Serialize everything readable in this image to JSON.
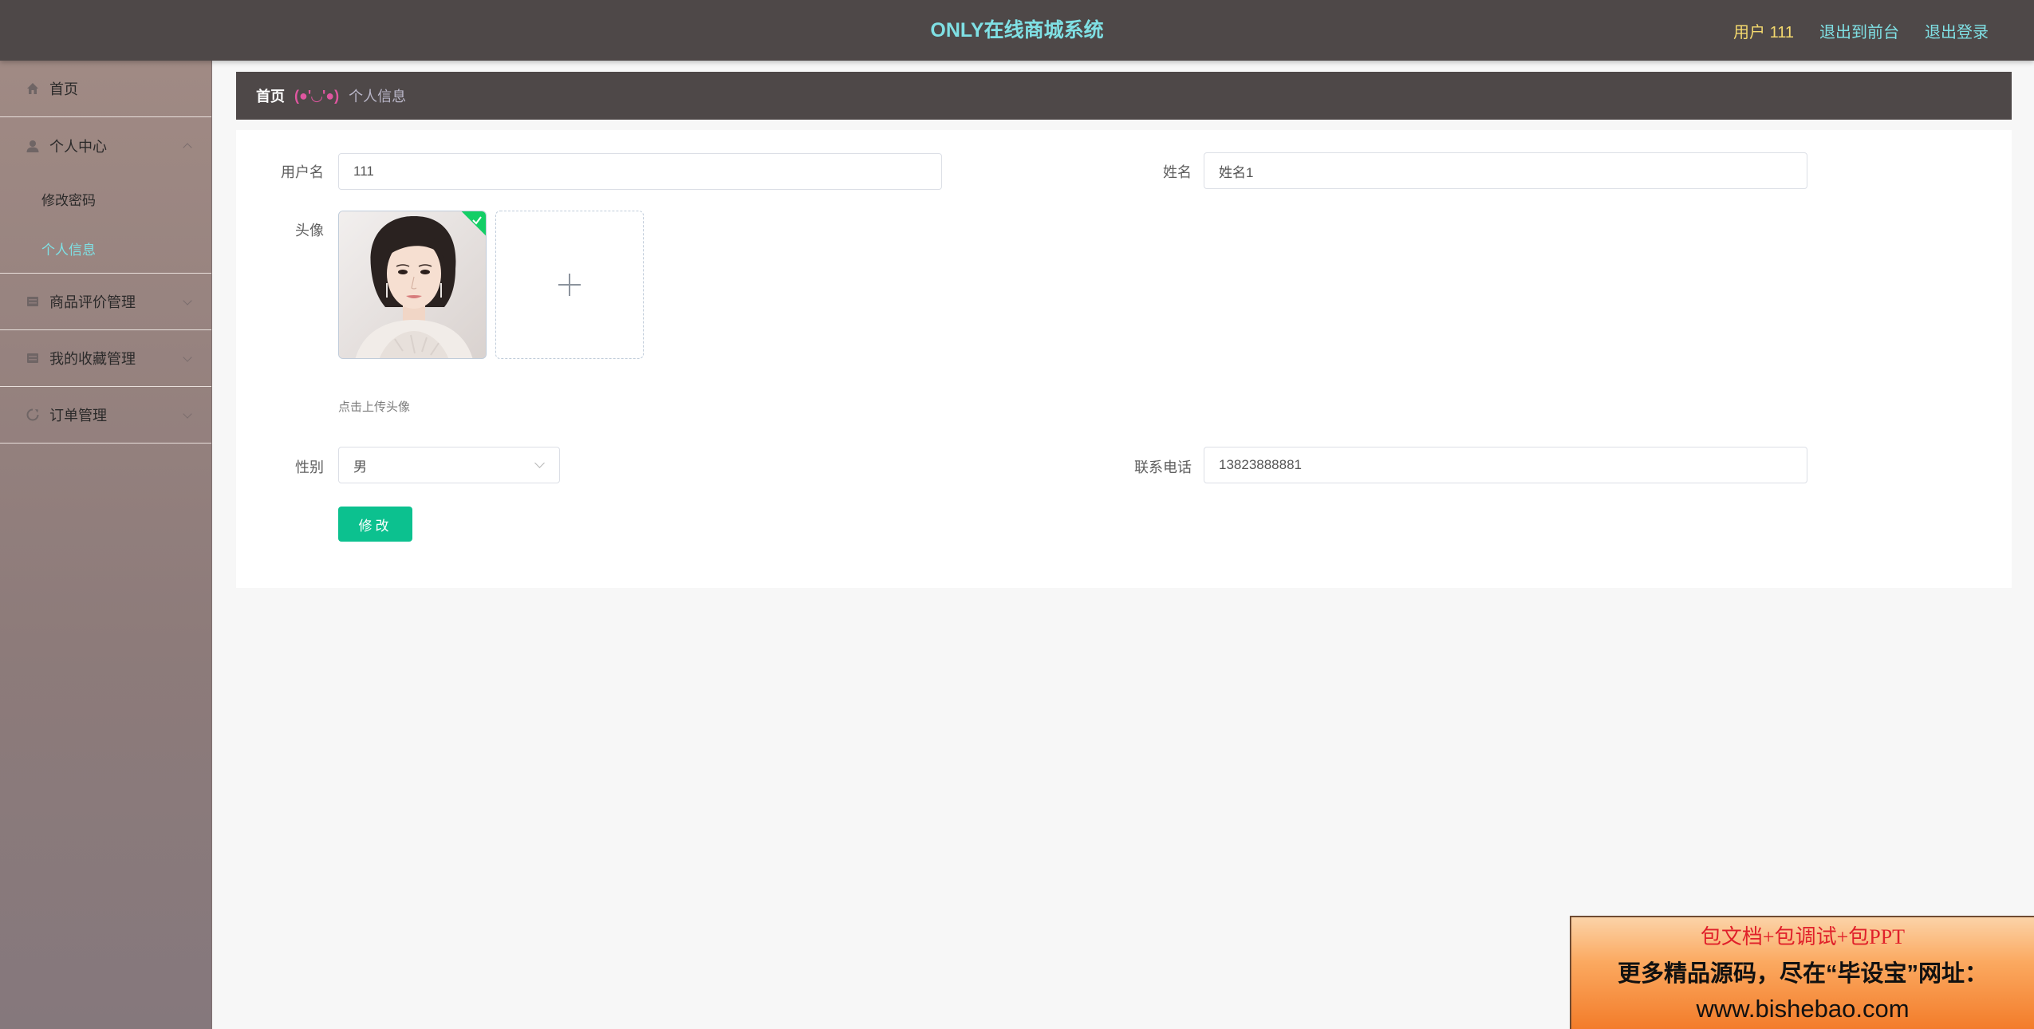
{
  "header": {
    "title": "ONLY在线商城系统",
    "user_label": "用户 111",
    "to_front_label": "退出到前台",
    "logout_label": "退出登录"
  },
  "sidebar": {
    "items": [
      {
        "label": "首页",
        "icon": "home-icon"
      },
      {
        "label": "个人中心",
        "icon": "user-icon",
        "expanded": true,
        "children": [
          {
            "label": "修改密码"
          },
          {
            "label": "个人信息",
            "active": true
          }
        ]
      },
      {
        "label": "商品评价管理",
        "icon": "grid-icon"
      },
      {
        "label": "我的收藏管理",
        "icon": "grid-icon"
      },
      {
        "label": "订单管理",
        "icon": "refresh-icon"
      }
    ]
  },
  "breadcrumb": {
    "home": "首页",
    "separator": "(●'◡'●)",
    "current": "个人信息"
  },
  "form": {
    "username_label": "用户名",
    "username_value": "111",
    "name_label": "姓名",
    "name_value": "姓名1",
    "avatar_label": "头像",
    "upload_hint": "点击上传头像",
    "gender_label": "性别",
    "gender_value": "男",
    "phone_label": "联系电话",
    "phone_value": "13823888881",
    "submit_label": "修改"
  },
  "banner": {
    "line1": "包文档+包调试+包PPT",
    "line2": "更多精品源码，尽在“毕设宝”网址：",
    "line3": "www.bishebao.com"
  },
  "colors": {
    "header_bg": "#4e4848",
    "title_color": "#7fe0e4",
    "user_color": "#f4d96e",
    "active_menu": "#7fe0e4",
    "primary_button": "#0cc18f",
    "success_badge": "#13ce66"
  }
}
